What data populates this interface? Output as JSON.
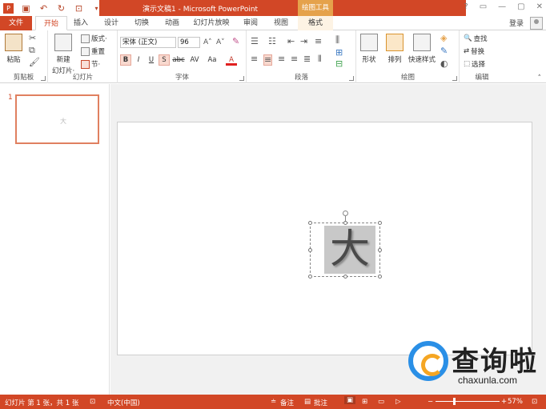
{
  "title_bar": {
    "title": "演示文稿1 - Microsoft PowerPoint",
    "contextual_tab": "绘图工具",
    "window_controls": [
      "?",
      "▭",
      "—",
      "▢",
      "✕"
    ]
  },
  "tabs": {
    "file": "文件",
    "items": [
      "开始",
      "插入",
      "设计",
      "切换",
      "动画",
      "幻灯片放映",
      "审阅",
      "视图"
    ],
    "format": "格式",
    "active": "开始"
  },
  "account": {
    "login": "登录"
  },
  "ribbon": {
    "clipboard": {
      "label": "剪贴板",
      "paste": "粘贴"
    },
    "slides": {
      "label": "幻灯片",
      "new_slide": "新建",
      "new_slide2": "幻灯片·",
      "layout": "版式·",
      "reset": "重置",
      "section": "节·"
    },
    "font": {
      "label": "字体",
      "font_name": "宋体 (正文)",
      "font_size": "96",
      "bold": "B",
      "italic": "I",
      "underline": "U",
      "shadow": "S",
      "strike": "abc",
      "spacing": "AV",
      "case": "Aa",
      "color": "A"
    },
    "paragraph": {
      "label": "段落"
    },
    "drawing": {
      "label": "绘图",
      "shapes": "形状",
      "arrange": "排列",
      "quick_styles": "快速样式"
    },
    "editing": {
      "label": "编辑",
      "find": "查找",
      "replace": "替换",
      "select": "选择"
    }
  },
  "slide_panel": {
    "slide_number": "1"
  },
  "slide": {
    "text": "大"
  },
  "status_bar": {
    "slide_info": "幻灯片 第 1 张，共 1 张",
    "language": "中文(中国)",
    "notes": "备注",
    "comments": "批注",
    "zoom": "57%"
  },
  "watermark": {
    "cn": "查询啦",
    "en": "chaxunla.com"
  }
}
